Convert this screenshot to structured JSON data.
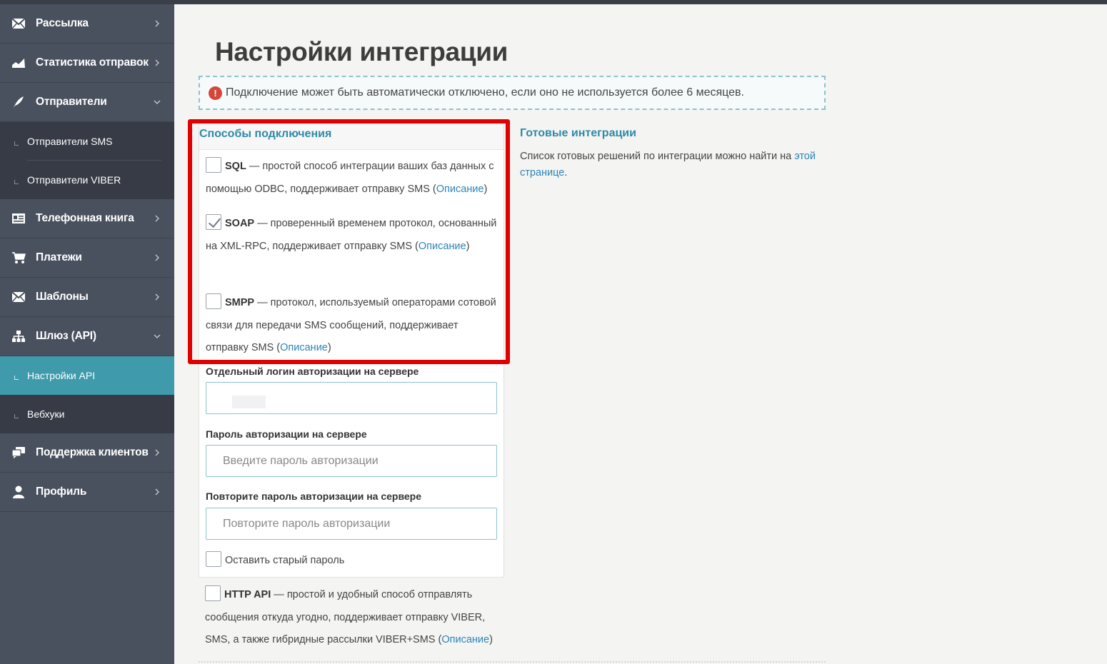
{
  "sidebar": {
    "items": [
      {
        "label": "Рассылка",
        "icon": "envelope-icon"
      },
      {
        "label": "Статистика отправок",
        "icon": "stats-chart-icon"
      },
      {
        "label": "Отправители",
        "icon": "feather-icon"
      },
      {
        "label": "Телефонная книга",
        "icon": "address-book-icon"
      },
      {
        "label": "Платежи",
        "icon": "cart-icon"
      },
      {
        "label": "Шаблоны",
        "icon": "envelope-icon"
      },
      {
        "label": "Шлюз (API)",
        "icon": "sitemap-icon"
      },
      {
        "label": "Поддержка клиентов",
        "icon": "chat-icon"
      },
      {
        "label": "Профиль",
        "icon": "user-icon"
      }
    ],
    "senders_sub": [
      "Отправители SMS",
      "Отправители VIBER"
    ],
    "api_sub": [
      "Настройки API",
      "Вебхуки"
    ]
  },
  "page": {
    "title": "Настройки интеграции",
    "notice": "Подключение может быть автоматически отключено, если оно не используется более 6 месяцев.",
    "notice_icon": "!"
  },
  "methods": {
    "title": "Способы подключения",
    "sql": {
      "name": "SQL",
      "desc": " — простой способ интеграции ваших баз данных с помощью ODBC, поддерживает отправку SMS (",
      "link": "Описание",
      "end": ")",
      "checked": false
    },
    "soap": {
      "name": "SOAP",
      "desc": " — проверенный временем протокол, основанный на XML-RPC, поддерживает отправку SMS (",
      "link": "Описание",
      "end": ")",
      "checked": true
    },
    "smpp": {
      "name": "SMPP",
      "desc": " — протокол, используемый операторами сотовой связи для передачи SMS сообщений, поддерживает отправку SMS (",
      "link": "Описание",
      "end": ")",
      "checked": false
    },
    "login_label": "Отдельный логин авторизации на сервере",
    "login_value": "",
    "password_label": "Пароль авторизации на сервере",
    "password_placeholder": "Введите пароль авторизации",
    "repeat_label": "Повторите пароль авторизации на сервере",
    "repeat_placeholder": "Повторите пароль авторизации",
    "keep_old": "Оставить старый пароль",
    "http": {
      "name": "HTTP API",
      "desc": " — простой и удобный способ отправлять сообщения откуда угодно, поддерживает отправку VIBER, SMS, а также гибридные рассылки VIBER+SMS (",
      "link": "Описание",
      "end": ")",
      "checked": false
    }
  },
  "ready": {
    "title": "Готовые интеграции",
    "text": "Список готовых решений по интеграции можно найти на ",
    "link": "этой странице",
    "end": "."
  },
  "colors": {
    "sidebar": "#4a515e",
    "active": "#3f9aac",
    "accent": "#2f8aa6",
    "highlight": "#e00000"
  }
}
